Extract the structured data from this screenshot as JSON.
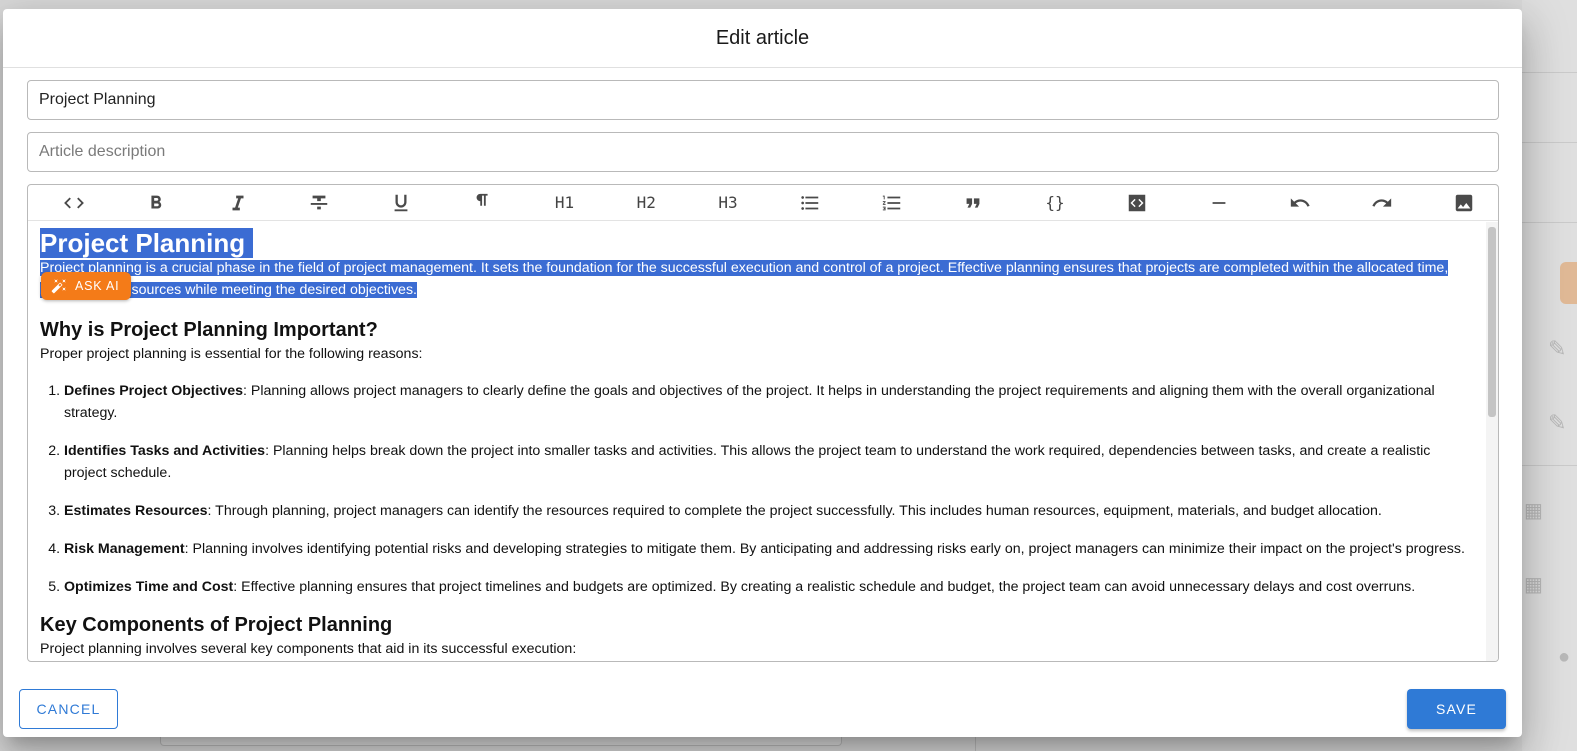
{
  "dialog": {
    "title": "Edit article"
  },
  "form": {
    "title_value": "Project Planning",
    "description_placeholder": "Article description"
  },
  "toolbar": {
    "items": [
      "code",
      "bold",
      "italic",
      "strikethrough",
      "underline",
      "paragraph",
      "H1",
      "H2",
      "H3",
      "bullet-list",
      "ordered-list",
      "blockquote",
      "{}",
      "code-block",
      "horizontal-rule",
      "undo",
      "redo",
      "image"
    ]
  },
  "article": {
    "h1": "Project Planning",
    "intro": "Project planning is a crucial phase in the field of project management. It sets the foundation for the successful execution and control of a project. Effective planning ensures that projects are completed within the allocated time, budget, and resources while meeting the desired objectives.",
    "h2_important": "Why is Project Planning Important?",
    "reasons_intro": "Proper project planning is essential for the following reasons:",
    "reasons": [
      {
        "term": "Defines Project Objectives",
        "text": ": Planning allows project managers to clearly define the goals and objectives of the project. It helps in understanding the project requirements and aligning them with the overall organizational strategy."
      },
      {
        "term": "Identifies Tasks and Activities",
        "text": ": Planning helps break down the project into smaller tasks and activities. This allows the project team to understand the work required, dependencies between tasks, and create a realistic project schedule."
      },
      {
        "term": "Estimates Resources",
        "text": ": Through planning, project managers can identify the resources required to complete the project successfully. This includes human resources, equipment, materials, and budget allocation."
      },
      {
        "term": "Risk Management",
        "text": ": Planning involves identifying potential risks and developing strategies to mitigate them. By anticipating and addressing risks early on, project managers can minimize their impact on the project's progress."
      },
      {
        "term": "Optimizes Time and Cost",
        "text": ": Effective planning ensures that project timelines and budgets are optimized. By creating a realistic schedule and budget, the project team can avoid unnecessary delays and cost overruns."
      }
    ],
    "h2_components": "Key Components of Project Planning",
    "components_intro": "Project planning involves several key components that aid in its successful execution:"
  },
  "ask_ai": {
    "label": "ASK AI"
  },
  "actions": {
    "cancel": "CANCEL",
    "save": "SAVE"
  },
  "colors": {
    "primary": "#2f7ad6",
    "ask_ai": "#f47b18",
    "selection": "#3b6cd3"
  }
}
